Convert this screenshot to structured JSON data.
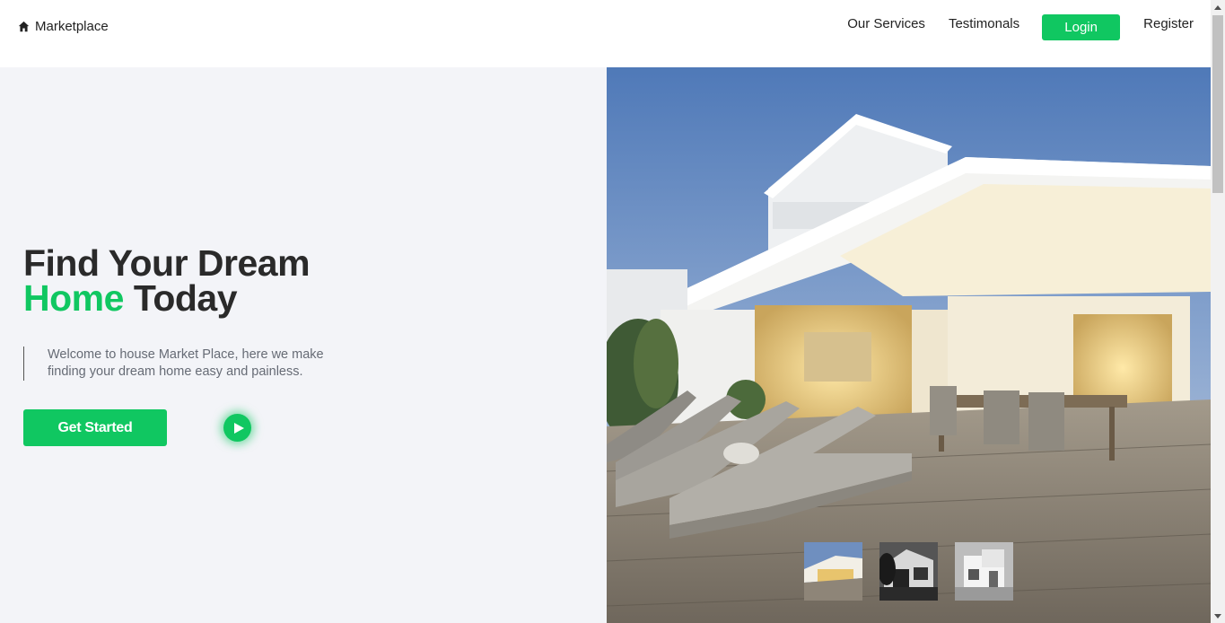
{
  "header": {
    "brand": {
      "icon": "home-icon",
      "label": "Marketplace"
    },
    "nav": {
      "services": "Our Services",
      "testimonials": "Testimonals",
      "login": "Login",
      "register": "Register"
    }
  },
  "hero": {
    "headline_line1": "Find Your Dream",
    "headline_accent": "Home",
    "headline_rest": " Today",
    "tagline": "Welcome to house Market Place, here we make finding your dream home easy and painless.",
    "cta": "Get Started",
    "play_icon": "play-icon"
  },
  "gallery": {
    "thumbnail_count": 3
  },
  "colors": {
    "accent": "#10c761",
    "hero_bg": "#f3f4f8",
    "text_dark": "#2a2a2a",
    "text_muted": "#666b75"
  }
}
